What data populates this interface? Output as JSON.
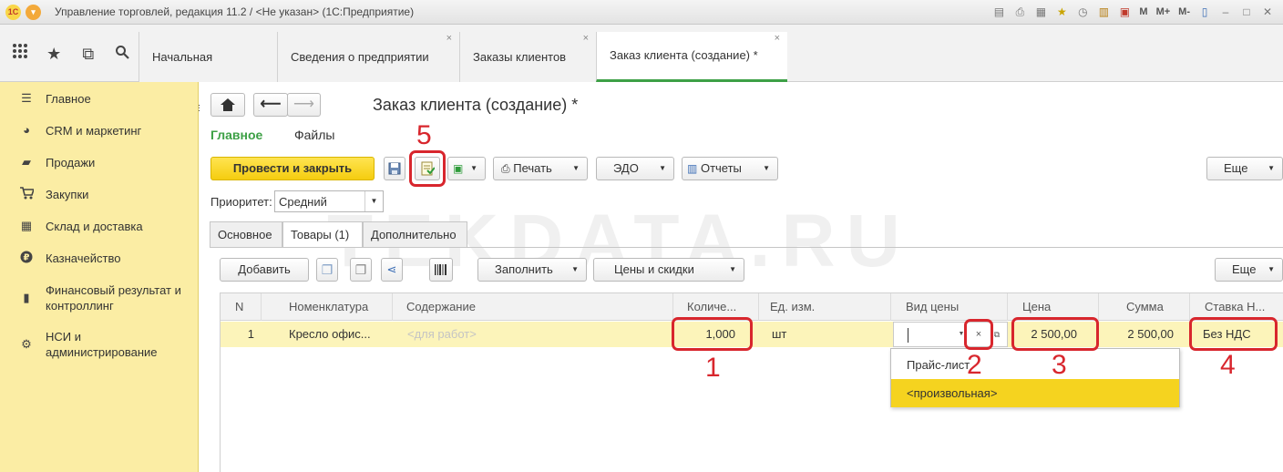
{
  "window": {
    "title": "Управление торговлей, редакция 11.2 / <Не указан>  (1С:Предприятие)",
    "toolbar_text_buttons": [
      "M",
      "M+",
      "M-"
    ]
  },
  "tabs": [
    {
      "label": "Начальная страница",
      "closable": false
    },
    {
      "label": "Сведения о предприятии",
      "closable": true
    },
    {
      "label": "Заказы клиентов",
      "closable": true
    },
    {
      "label": "Заказ клиента (создание) *",
      "closable": true
    }
  ],
  "sidebar": {
    "items": [
      {
        "label": "Главное",
        "icon": "menu-icon"
      },
      {
        "label": "CRM и маркетинг",
        "icon": "pie-chart-icon"
      },
      {
        "label": "Продажи",
        "icon": "bag-icon"
      },
      {
        "label": "Закупки",
        "icon": "cart-icon"
      },
      {
        "label": "Склад и доставка",
        "icon": "warehouse-icon"
      },
      {
        "label": "Казначейство",
        "icon": "ruble-icon"
      },
      {
        "label": "Финансовый результат и контроллинг",
        "icon": "chart-icon"
      },
      {
        "label": "НСИ и администрирование",
        "icon": "gear-icon"
      }
    ]
  },
  "form": {
    "title": "Заказ клиента (создание) *",
    "subtabs": [
      "Главное",
      "Файлы"
    ],
    "toolbar": {
      "post_close": "Провести и закрыть",
      "print": "Печать",
      "edo": "ЭДО",
      "reports": "Отчеты",
      "more": "Еще"
    },
    "priority": {
      "label": "Приоритет:",
      "value": "Средний"
    },
    "tabs": [
      "Основное",
      "Товары (1)",
      "Дополнительно"
    ],
    "goods_toolbar": {
      "add": "Добавить",
      "fill": "Заполнить",
      "prices": "Цены и скидки",
      "more": "Еще"
    }
  },
  "table": {
    "columns": [
      "N",
      "Номенклатура",
      "Содержание",
      "Количе...",
      "Ед. изм.",
      "Вид цены",
      "Цена",
      "Сумма",
      "Ставка Н..."
    ],
    "rows": [
      {
        "n": "1",
        "item": "Кресло офис...",
        "content_placeholder": "<для работ>",
        "qty": "1,000",
        "unit": "шт",
        "price_type": "",
        "price": "2 500,00",
        "sum": "2 500,00",
        "vat": "Без НДС"
      }
    ]
  },
  "price_type_dropdown": {
    "options": [
      "Прайс-лист",
      "<произвольная>"
    ],
    "selected": 1
  },
  "annotations": [
    "1",
    "2",
    "3",
    "4",
    "5"
  ],
  "watermark": "TEKDATA.RU",
  "colors": {
    "accent_green": "#3da046",
    "sidebar_yellow": "#fbeda4",
    "button_yellow": "#f5cd0f",
    "annotation_red": "#d8262d",
    "row_highlight": "#fcf4ba",
    "selected_option": "#f5d31f"
  }
}
